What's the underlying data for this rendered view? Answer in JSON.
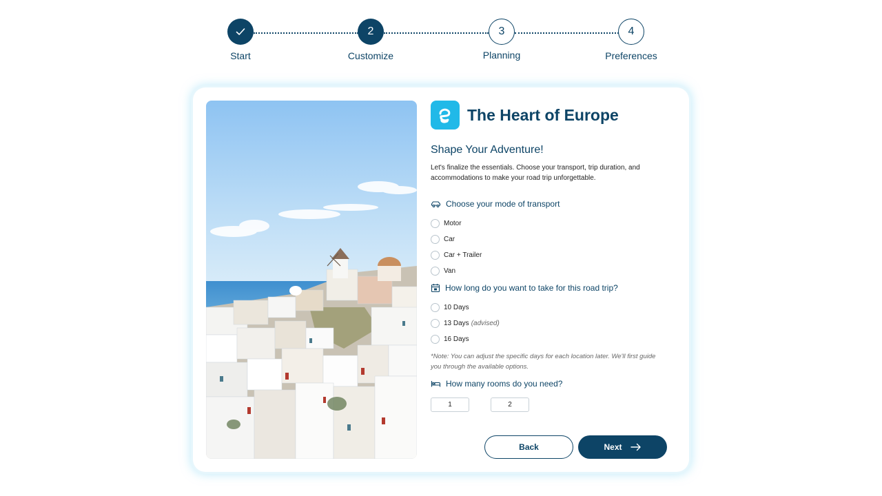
{
  "stepper": {
    "steps": [
      {
        "number": "",
        "label": "Start",
        "state": "done",
        "icon": "check-icon"
      },
      {
        "number": "2",
        "label": "Customize",
        "state": "active"
      },
      {
        "number": "3",
        "label": "Planning",
        "state": "pending"
      },
      {
        "number": "4",
        "label": "Preferences",
        "state": "pending"
      }
    ]
  },
  "brand": {
    "title": "The Heart of Europe",
    "logo_icon": "brand-logo-icon"
  },
  "main": {
    "subtitle": "Shape Your Adventure!",
    "description": "Let's finalize the essentials. Choose your transport, trip duration, and accommodations to make your road trip unforgettable."
  },
  "transport": {
    "question": "Choose your mode of transport",
    "icon": "car-icon",
    "options": [
      "Motor",
      "Car",
      "Car + Trailer",
      "Van"
    ]
  },
  "duration": {
    "question": "How long do you want to take for this road trip?",
    "icon": "calendar-icon",
    "options": [
      "10 Days",
      "13 Days",
      "16 Days"
    ],
    "advised": "(advised)",
    "note": "*Note: You can adjust the specific days for each location later. We'll first guide you through the available options."
  },
  "rooms": {
    "question": "How many rooms do you need?",
    "icon": "bed-icon",
    "options": [
      "1",
      "2"
    ]
  },
  "actions": {
    "back": "Back",
    "next": "Next",
    "next_icon": "arrow-right-icon"
  },
  "colors": {
    "primary": "#0d4466",
    "brand_accent": "#21b9e8",
    "card_glow": "#96dcf5"
  }
}
